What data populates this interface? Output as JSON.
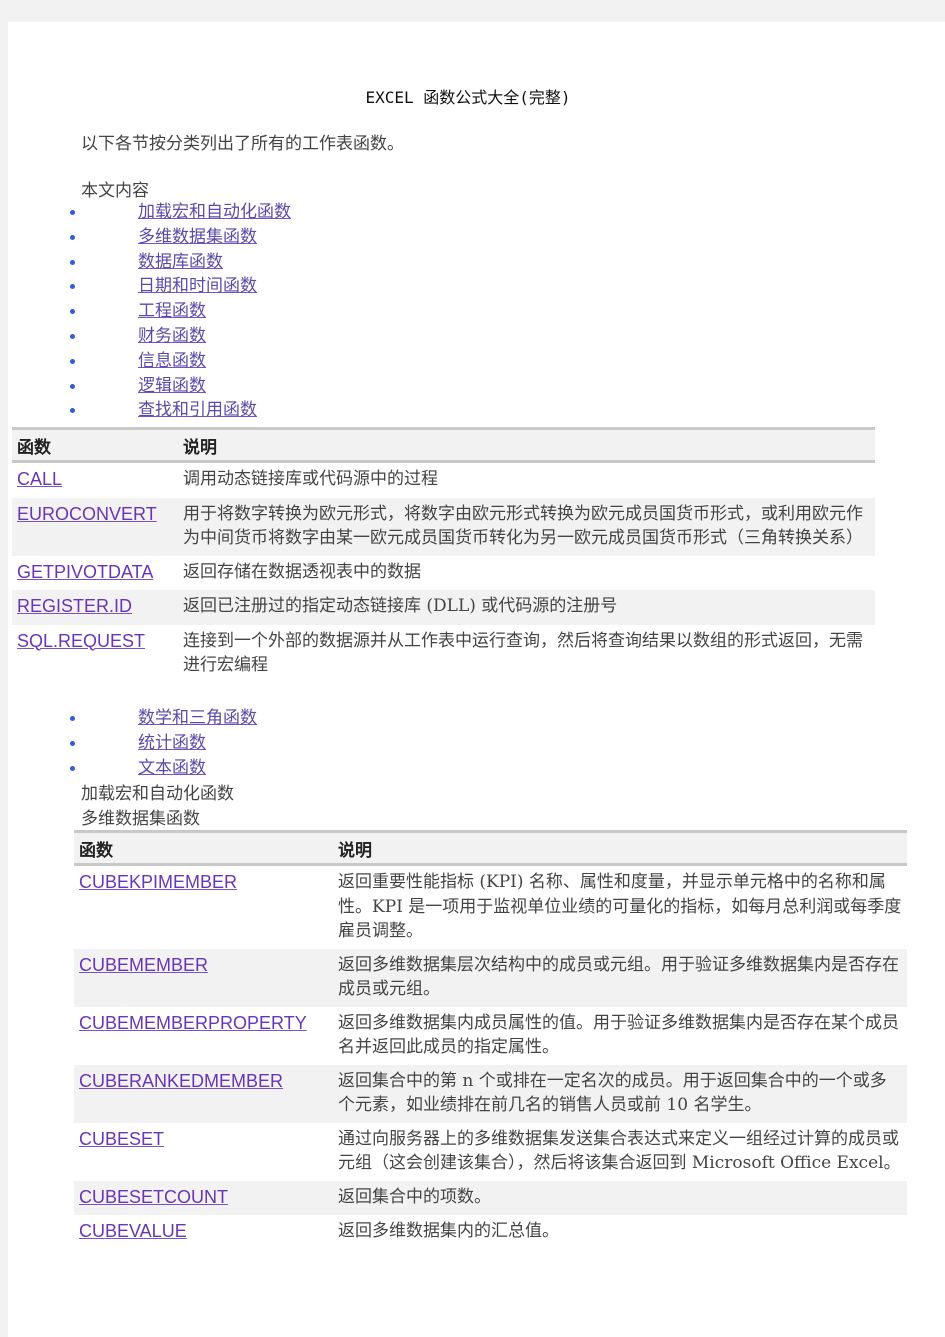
{
  "document": {
    "title": "EXCEL 函数公式大全(完整)",
    "intro": "以下各节按分类列出了所有的工作表函数。",
    "toc_heading": "本文内容",
    "toc_part1": [
      {
        "label": "加载宏和自动化函数"
      },
      {
        "label": "多维数据集函数"
      },
      {
        "label": "数据库函数"
      },
      {
        "label": "日期和时间函数"
      },
      {
        "label": "工程函数"
      },
      {
        "label": "财务函数"
      },
      {
        "label": "信息函数"
      },
      {
        "label": "逻辑函数"
      },
      {
        "label": "查找和引用函数"
      }
    ],
    "toc_part2": [
      {
        "label": "数学和三角函数"
      },
      {
        "label": "统计函数"
      },
      {
        "label": "文本函数"
      }
    ],
    "section_addins": "加载宏和自动化函数",
    "section_cube": "多维数据集函数"
  },
  "table_addins": {
    "headers": {
      "function": "函数",
      "description": "说明"
    },
    "rows": [
      {
        "name": "CALL",
        "desc": "调用动态链接库或代码源中的过程"
      },
      {
        "name": "EUROCONVERT",
        "desc": "用于将数字转换为欧元形式，将数字由欧元形式转换为欧元成员国货币形式，或利用欧元作为中间货币将数字由某一欧元成员国货币转化为另一欧元成员国货币形式（三角转换关系）"
      },
      {
        "name": "GETPIVOTDATA",
        "desc": "返回存储在数据透视表中的数据"
      },
      {
        "name": "REGISTER.ID",
        "desc": "返回已注册过的指定动态链接库 (DLL) 或代码源的注册号"
      },
      {
        "name": "SQL.REQUEST",
        "desc": "连接到一个外部的数据源并从工作表中运行查询，然后将查询结果以数组的形式返回，无需进行宏编程"
      }
    ]
  },
  "table_cube": {
    "headers": {
      "function": "函数",
      "description": "说明"
    },
    "rows": [
      {
        "name": "CUBEKPIMEMBER",
        "desc": "返回重要性能指标 (KPI) 名称、属性和度量，并显示单元格中的名称和属性。KPI 是一项用于监视单位业绩的可量化的指标，如每月总利润或每季度雇员调整。"
      },
      {
        "name": "CUBEMEMBER",
        "desc": "返回多维数据集层次结构中的成员或元组。用于验证多维数据集内是否存在成员或元组。"
      },
      {
        "name": "CUBEMEMBERPROPERTY",
        "desc": "返回多维数据集内成员属性的值。用于验证多维数据集内是否存在某个成员名并返回此成员的指定属性。"
      },
      {
        "name": "CUBERANKEDMEMBER",
        "desc": "返回集合中的第 n 个或排在一定名次的成员。用于返回集合中的一个或多个元素，如业绩排在前几名的销售人员或前 10 名学生。"
      },
      {
        "name": "CUBESET",
        "desc": "通过向服务器上的多维数据集发送集合表达式来定义一组经过计算的成员或元组（这会创建该集合），然后将该集合返回到 Microsoft Office Excel。"
      },
      {
        "name": "CUBESETCOUNT",
        "desc": "返回集合中的项数。"
      },
      {
        "name": "CUBEVALUE",
        "desc": "返回多维数据集内的汇总值。"
      }
    ]
  },
  "colors": {
    "link": "#6a35b5",
    "bullet": "#2f5fd0",
    "header_bg": "#f2f2f2",
    "alt_row_bg": "#f2f2f2",
    "border": "#c8c8c8"
  }
}
